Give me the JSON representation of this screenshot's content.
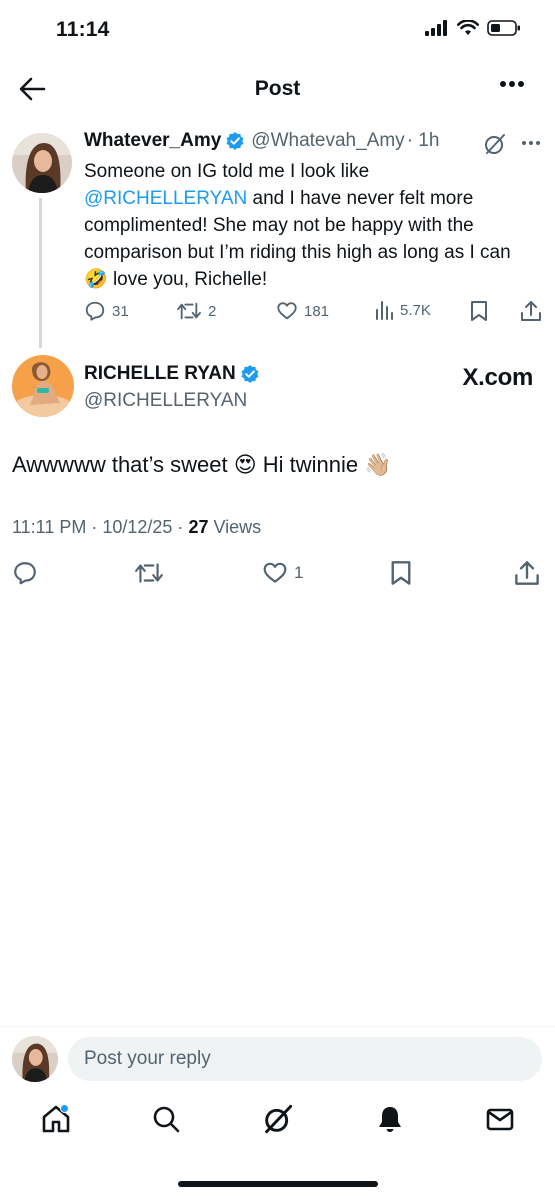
{
  "status_bar": {
    "time": "11:14"
  },
  "header": {
    "title": "Post"
  },
  "tweet1": {
    "name": "Whatever_Amy",
    "handle": "@Whatevah_Amy",
    "time": "· 1h",
    "text_line1": "Someone on IG told me I look like",
    "mention": "@RICHELLERYAN",
    "text_after_mention": " and I have never felt more complimented! She may not be happy with the comparison but I’m riding this high as long as I can ",
    "emoji": "🤣",
    "text_end": " love you, Richelle!",
    "replies": "31",
    "reposts": "2",
    "likes": "181",
    "views": "5.7K"
  },
  "tweet2": {
    "name": "RICHELLE RYAN",
    "handle": "@RICHELLERYAN",
    "watermark": "X.com",
    "text_part1": "Awwwww that’s sweet ",
    "emoji1": "😍",
    "text_part2": " Hi twinnie ",
    "emoji2": "👋🏼",
    "timestamp": "11:11 PM · 10/12/25 · ",
    "views_count": "27",
    "views_label": " Views",
    "likes": "1"
  },
  "reply": {
    "placeholder": "Post your reply"
  },
  "colors": {
    "accent": "#1d9bf0",
    "muted": "#536471",
    "text": "#0f1419"
  },
  "icons": [
    "back-arrow-icon",
    "more-icon",
    "grok-icon",
    "verified-icon",
    "reply-icon",
    "repost-icon",
    "like-icon",
    "views-icon",
    "bookmark-icon",
    "share-icon",
    "home-icon",
    "search-icon",
    "bell-icon",
    "mail-icon"
  ]
}
